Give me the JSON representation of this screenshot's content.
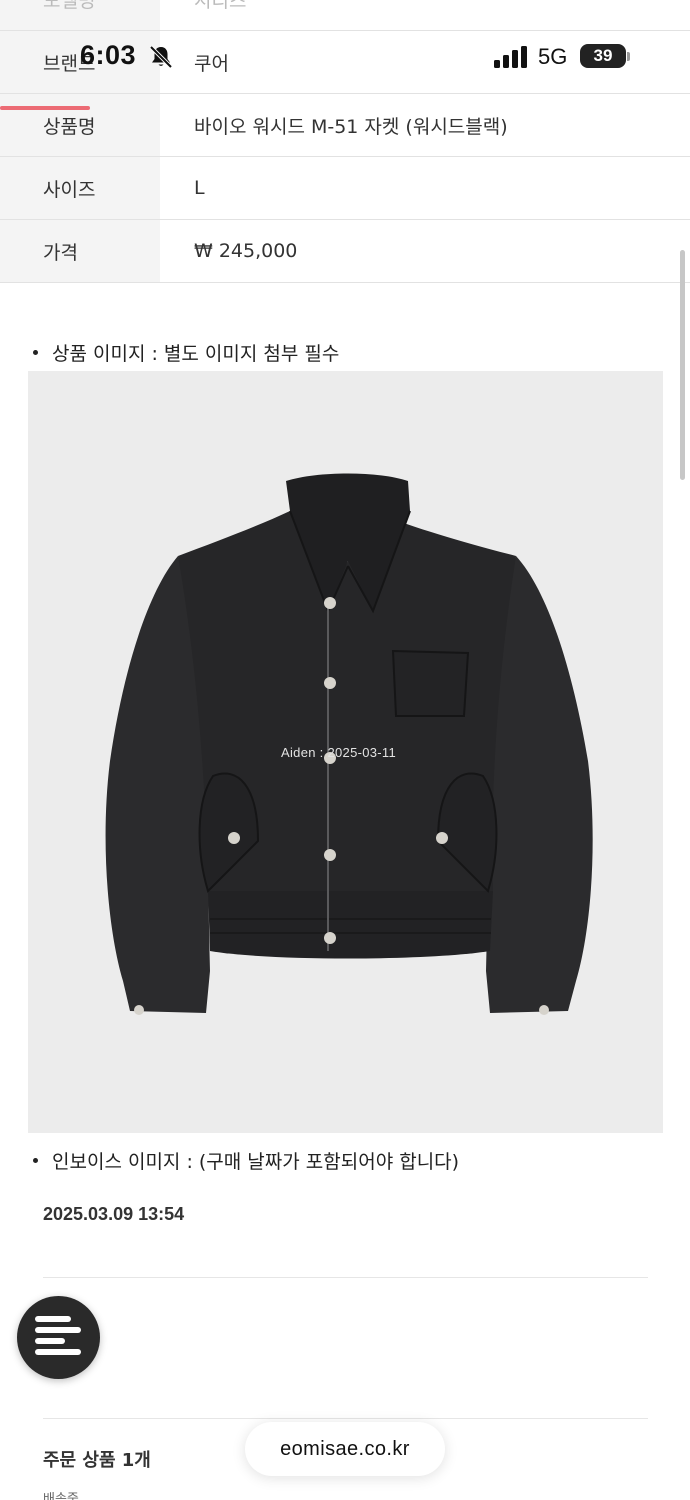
{
  "status_bar": {
    "time": "6:03",
    "network": "5G",
    "battery": "39"
  },
  "info_table": [
    {
      "label": "모델명",
      "value": "시리즈"
    },
    {
      "label": "브랜드",
      "value": "쿠어"
    },
    {
      "label": "상품명",
      "value": "바이오 워시드 M-51 자켓 (워시드블랙)"
    },
    {
      "label": "사이즈",
      "value": "L"
    },
    {
      "label": "가격",
      "value": "₩ 245,000"
    }
  ],
  "product_image_section": {
    "heading": "상품 이미지 : 별도 이미지 첨부 필수",
    "watermark": "Aiden : 2025-03-11"
  },
  "invoice_section": {
    "heading": "인보이스 이미지 :  (구매 날짜가 포함되어야 합니다)",
    "date": "2025.03.09 13:54"
  },
  "order": {
    "title": "주문 상품 1개",
    "shipping_label": "배송중"
  },
  "url_bar": {
    "domain": "eomisae.co.kr"
  },
  "icons": {
    "bell": "bell-slash-icon",
    "signal": "cellular-signal-icon",
    "menu": "menu-icon"
  },
  "colors": {
    "accent_line": "#ec6b74",
    "fab": "#2a2a2a"
  }
}
